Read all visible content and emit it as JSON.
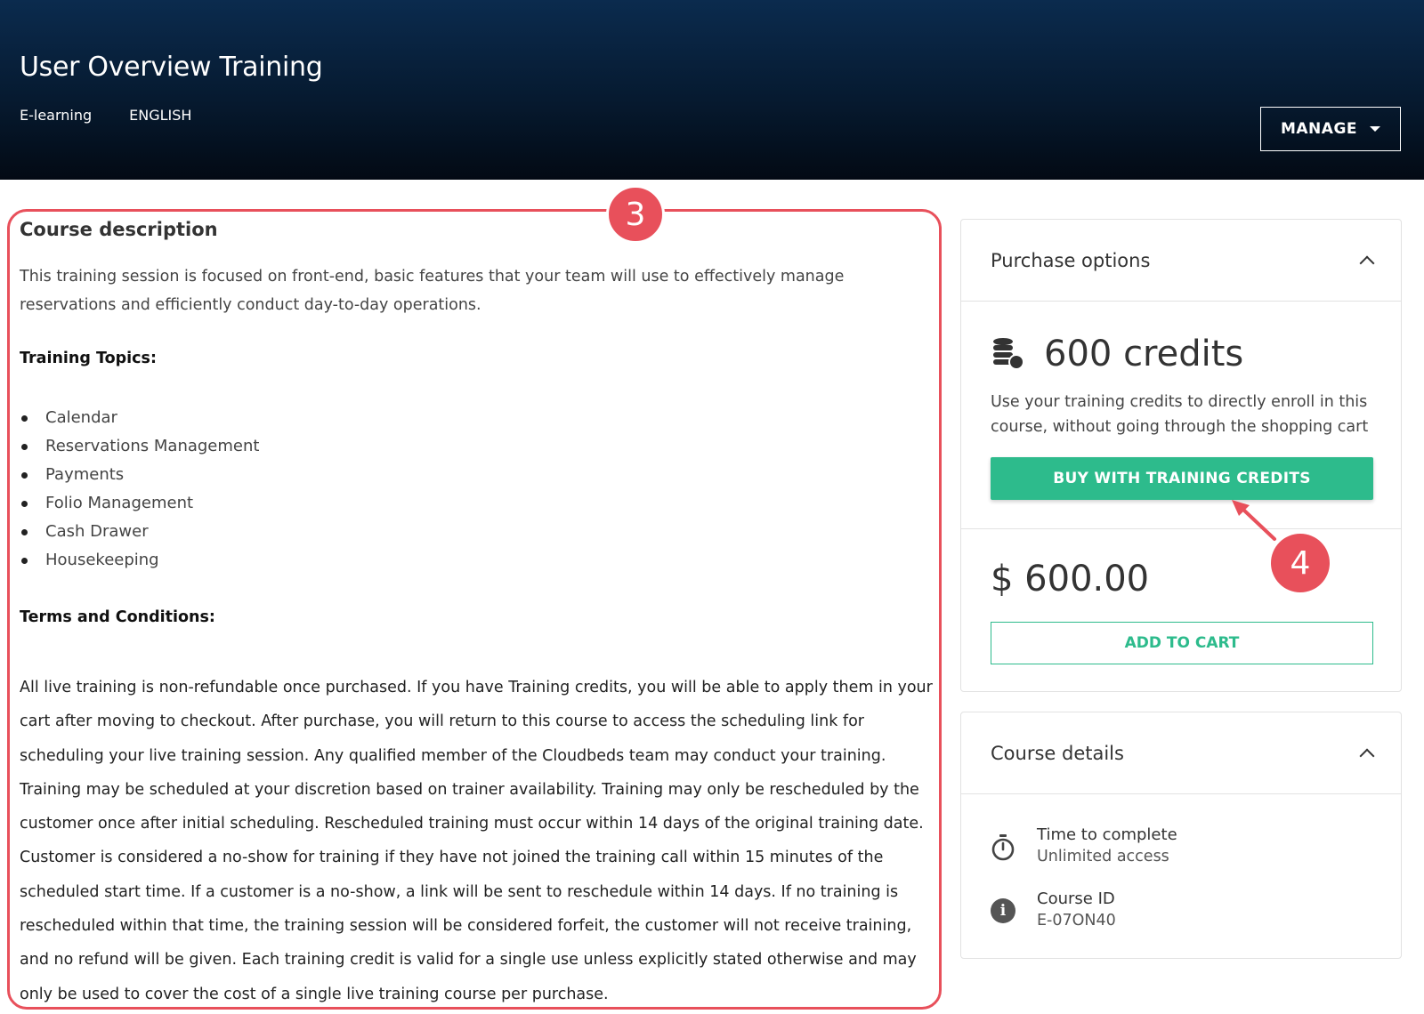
{
  "header": {
    "title": "User Overview Training",
    "format": "E-learning",
    "language": "ENGLISH",
    "manage_label": "MANAGE"
  },
  "description": {
    "heading": "Course description",
    "intro": "This training session is focused on front-end, basic features that your team will use to effectively manage reservations and efficiently conduct day-to-day operations.",
    "topics_label": "Training Topics:",
    "topics": [
      "Calendar",
      "Reservations Management",
      "Payments",
      "Folio Management",
      "Cash Drawer",
      "Housekeeping"
    ],
    "terms_label": "Terms and Conditions:",
    "terms": "All live training is non-refundable once purchased. If you have Training credits, you will be able to apply them in your cart after moving to checkout. After purchase, you will return to this course to access the scheduling link for scheduling your live training session. Any qualified member of the Cloudbeds team may conduct your training. Training may be scheduled at your discretion based on trainer availability. Training may only be rescheduled by the customer once after initial scheduling. Rescheduled training must occur within 14 days of the original training date. Customer is considered a no-show for training if they have not joined the training call within 15 minutes of the scheduled start time. If a customer is a no-show, a link will be sent to reschedule within 14 days. If no training is rescheduled within that time, the training session will be considered forfeit, the customer will not receive training, and no refund will be given. Each training credit is valid for a single use unless explicitly stated otherwise and may only be used to cover the cost of a single live training course per purchase."
  },
  "purchase": {
    "title": "Purchase options",
    "credits_amount": "600 credits",
    "credits_note": "Use your training credits to directly enroll in this course, without going through the shopping cart",
    "buy_label": "BUY WITH TRAINING CREDITS",
    "price": "$ 600.00",
    "cart_label": "ADD TO CART"
  },
  "details": {
    "title": "Course details",
    "time_label": "Time to complete",
    "time_value": "Unlimited access",
    "id_label": "Course ID",
    "id_value": "E-07ON40"
  },
  "annotations": {
    "badge_3": "3",
    "badge_4": "4",
    "color": "#e8505b"
  },
  "colors": {
    "accent_green": "#2dbb8c",
    "header_dark": "#061a30"
  },
  "icons": {
    "credits": "coins-stack-icon",
    "time": "stopwatch-icon",
    "info": "info-icon",
    "manage_caret": "caret-down-icon",
    "collapse": "chevron-up-icon"
  }
}
